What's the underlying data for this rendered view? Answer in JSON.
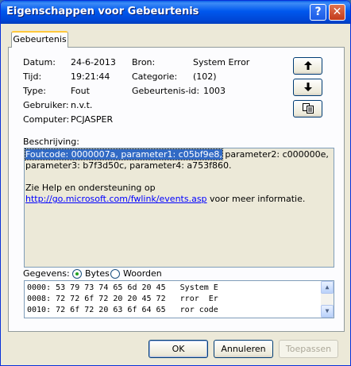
{
  "window": {
    "title": "Eigenschappen voor Gebeurtenis",
    "help_label": "?",
    "close_label": "✕"
  },
  "tab": {
    "label": "Gebeurtenis"
  },
  "fields": {
    "datum_label": "Datum:",
    "datum_value": "24-6-2013",
    "tijd_label": "Tijd:",
    "tijd_value": "19:21:44",
    "type_label": "Type:",
    "type_value": "Fout",
    "gebruiker_label": "Gebruiker:",
    "gebruiker_value": "n.v.t.",
    "computer_label": "Computer:",
    "computer_value": "PCJASPER",
    "bron_label": "Bron:",
    "bron_value": "System Error",
    "categorie_label": "Categorie:",
    "categorie_value": "(102)",
    "id_label": "Gebeurtenis-id:",
    "id_value": "1003"
  },
  "nav": {
    "up_icon": "arrow-up-icon",
    "down_icon": "arrow-down-icon",
    "copy_icon": "copy-icon"
  },
  "description": {
    "label": "Beschrijving:",
    "selected": "Foutcode: 0000007a, parameter1: c05bf9e8,",
    "rest": " parameter2: c000000e, parameter3: b7f3d50c, parameter4: a753f860.",
    "help_prefix": "Zie Help en ondersteuning op ",
    "link": "http://go.microsoft.com/fwlink/events.asp",
    "help_suffix": " voor meer informatie."
  },
  "data_section": {
    "label": "Gegevens:",
    "bytes_label": "Bytes",
    "words_label": "Woorden",
    "selected_mode": "Bytes",
    "lines": [
      "0000: 53 79 73 74 65 6d 20 45   System E",
      "0008: 72 72 6f 72 20 20 45 72   rror  Er",
      "0010: 72 6f 72 20 63 6f 64 65   ror code"
    ]
  },
  "buttons": {
    "ok": "OK",
    "cancel": "Annuleren",
    "apply": "Toepassen"
  },
  "colors": {
    "title_bar": "#0058ee",
    "selection": "#316ac5",
    "link": "#0000ff"
  }
}
